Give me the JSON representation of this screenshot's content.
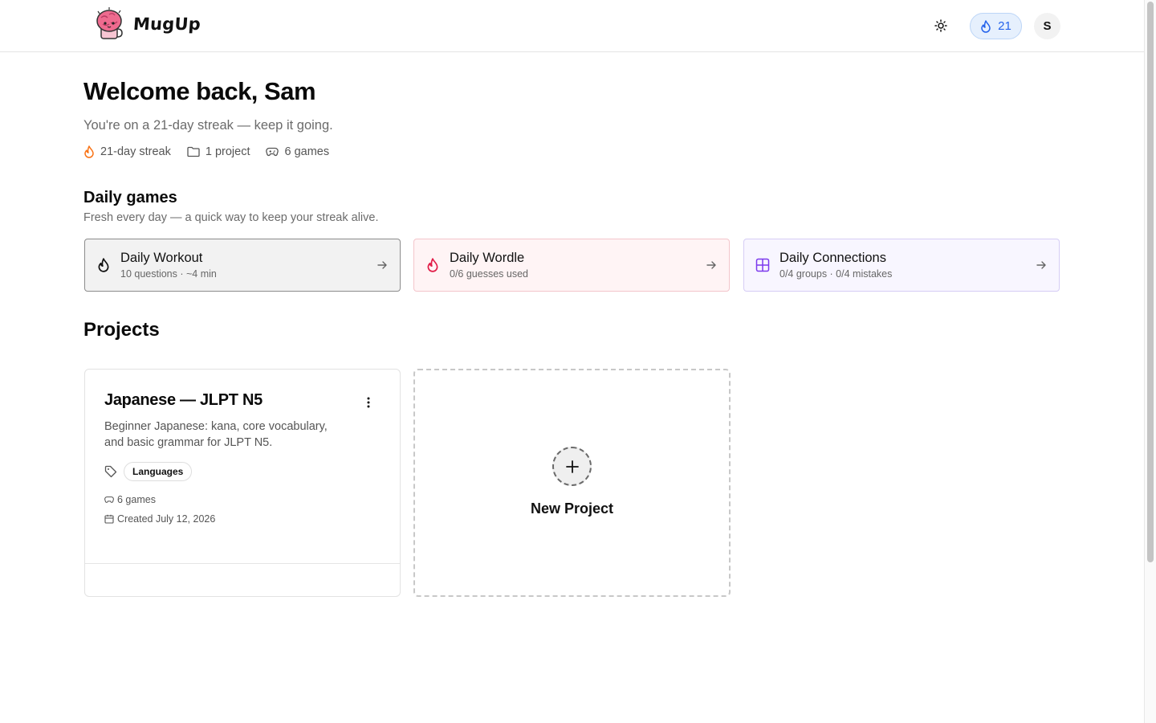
{
  "header": {
    "app_name": "MugUp",
    "streak_count": "21",
    "avatar_initial": "S",
    "accent_color": "#2563eb"
  },
  "welcome": {
    "title": "Welcome back, Sam",
    "subtitle": "You're on a 21-day streak — keep it going.",
    "stats": {
      "streak": "21-day streak",
      "projects": "1 project",
      "games": "6 games"
    }
  },
  "daily_games": {
    "title": "Daily games",
    "subtitle": "Fresh every day — a quick way to keep your streak alive.",
    "cards": [
      {
        "title": "Daily Workout",
        "subtitle": "10 questions · ~4 min",
        "icon": "flame-icon"
      },
      {
        "title": "Daily Wordle",
        "subtitle": "0/6 guesses used",
        "icon": "flame-icon",
        "color": "#e11d48"
      },
      {
        "title": "Daily Connections",
        "subtitle": "0/4 groups · 0/4 mistakes",
        "icon": "grid-icon",
        "color": "#7c3aed"
      }
    ]
  },
  "projects": {
    "title": "Projects",
    "items": [
      {
        "title": "Japanese — JLPT N5",
        "description": "Beginner Japanese: kana, core vocabulary, and basic grammar for JLPT N5.",
        "tag": "Languages",
        "games": "6 games",
        "created": "Created July 12, 2026"
      }
    ],
    "new_label": "New Project"
  }
}
